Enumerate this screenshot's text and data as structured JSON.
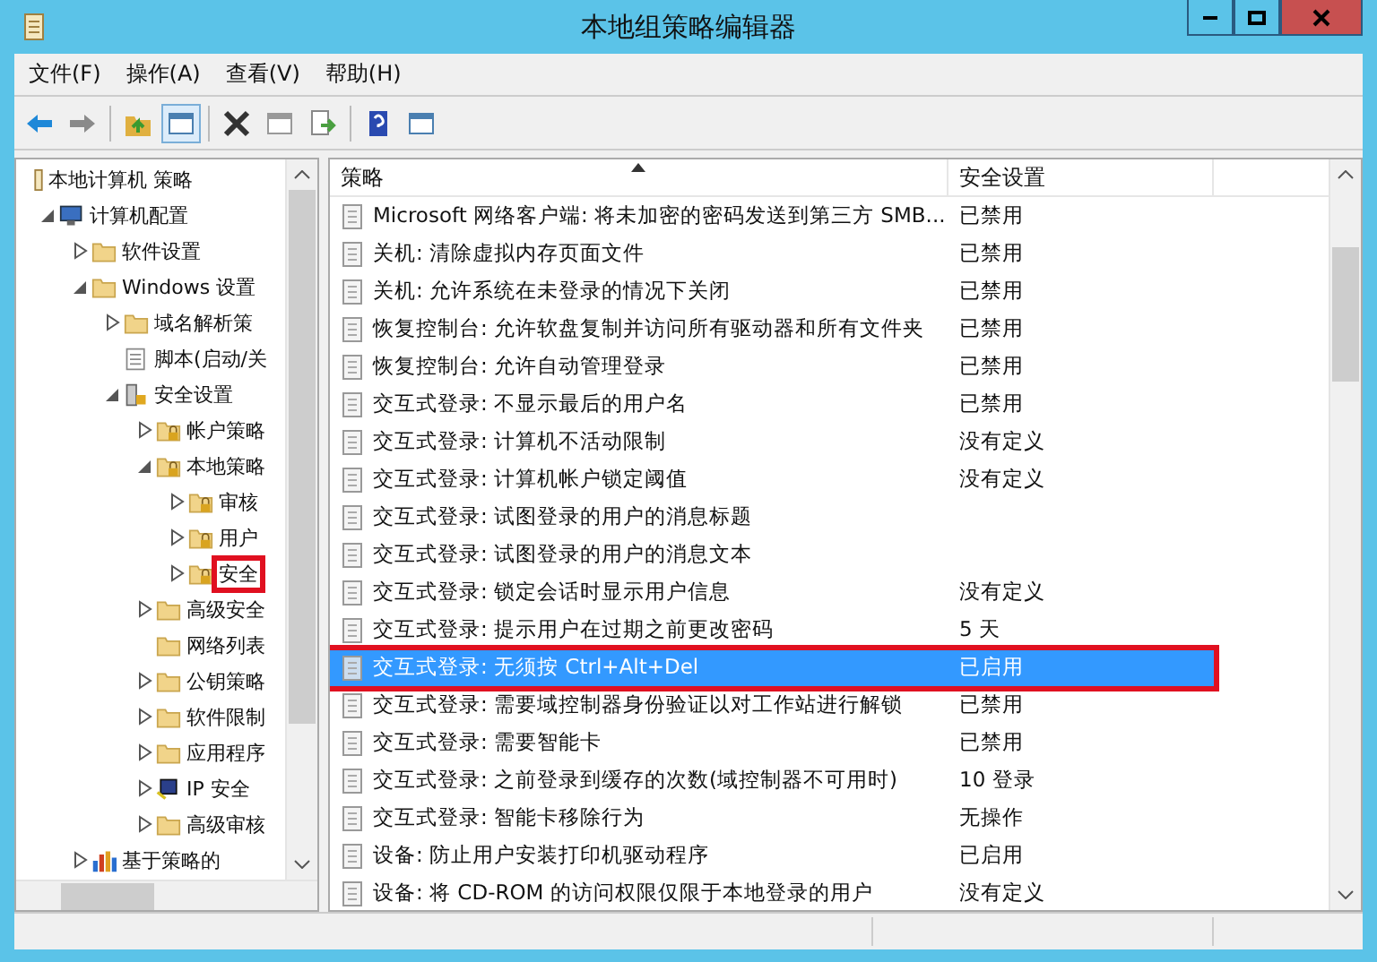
{
  "window": {
    "title": "本地组策略编辑器"
  },
  "menu": [
    {
      "label": "文件(F)"
    },
    {
      "label": "操作(A)"
    },
    {
      "label": "查看(V)"
    },
    {
      "label": "帮助(H)"
    }
  ],
  "toolbar": [
    {
      "kind": "back"
    },
    {
      "kind": "forward"
    },
    {
      "kind": "sep"
    },
    {
      "kind": "up"
    },
    {
      "kind": "pane",
      "selected": true
    },
    {
      "kind": "sep"
    },
    {
      "kind": "delete"
    },
    {
      "kind": "props"
    },
    {
      "kind": "export"
    },
    {
      "kind": "sep"
    },
    {
      "kind": "help"
    },
    {
      "kind": "view"
    }
  ],
  "tree": [
    {
      "label": "本地计算机 策略",
      "kind": "doc",
      "annotated": false,
      "children": [
        {
          "label": "计算机配置",
          "kind": "computer",
          "expanded": true,
          "annotated": false,
          "children": [
            {
              "label": "软件设置",
              "kind": "folder",
              "expanded": false,
              "annotated": false
            },
            {
              "label": "Windows 设置",
              "kind": "folder",
              "expanded": true,
              "annotated": false,
              "children": [
                {
                  "label": "域名解析策",
                  "kind": "folder",
                  "expanded": false,
                  "annotated": false
                },
                {
                  "label": "脚本(启动/关",
                  "kind": "script",
                  "annotated": false
                },
                {
                  "label": "安全设置",
                  "kind": "server",
                  "expanded": true,
                  "annotated": false,
                  "children": [
                    {
                      "label": "帐户策略",
                      "kind": "lockfolder",
                      "expanded": false,
                      "annotated": false
                    },
                    {
                      "label": "本地策略",
                      "kind": "lockfolder",
                      "expanded": true,
                      "annotated": false,
                      "children": [
                        {
                          "label": "审核",
                          "kind": "lockfolder",
                          "expanded": false,
                          "annotated": false
                        },
                        {
                          "label": "用户",
                          "kind": "lockfolder",
                          "expanded": false,
                          "annotated": false
                        },
                        {
                          "label": "安全",
                          "kind": "lockfolder",
                          "expanded": false,
                          "annotated": true
                        }
                      ]
                    },
                    {
                      "label": "高级安全",
                      "kind": "folder",
                      "expanded": false,
                      "annotated": false
                    },
                    {
                      "label": "网络列表",
                      "kind": "folder",
                      "annotated": false
                    },
                    {
                      "label": "公钥策略",
                      "kind": "folder",
                      "expanded": false,
                      "annotated": false
                    },
                    {
                      "label": "软件限制",
                      "kind": "folder",
                      "expanded": false,
                      "annotated": false
                    },
                    {
                      "label": "应用程序",
                      "kind": "folder",
                      "expanded": false,
                      "annotated": false
                    },
                    {
                      "label": "IP 安全",
                      "kind": "ipsec",
                      "expanded": false,
                      "annotated": false
                    },
                    {
                      "label": "高级审核",
                      "kind": "folder",
                      "expanded": false,
                      "annotated": false
                    }
                  ]
                }
              ]
            },
            {
              "label": "基于策略的",
              "kind": "chart",
              "expanded": false,
              "annotated": false
            }
          ]
        }
      ]
    }
  ],
  "table": {
    "columns": [
      {
        "label": "策略",
        "sorted": true
      },
      {
        "label": "安全设置",
        "sorted": false
      }
    ],
    "rows": [
      {
        "policy": "Microsoft 网络客户端: 将未加密的密码发送到第三方 SMB...",
        "setting": "已禁用",
        "selected": false,
        "annotated": false
      },
      {
        "policy": "关机: 清除虚拟内存页面文件",
        "setting": "已禁用",
        "selected": false,
        "annotated": false
      },
      {
        "policy": "关机: 允许系统在未登录的情况下关闭",
        "setting": "已禁用",
        "selected": false,
        "annotated": false
      },
      {
        "policy": "恢复控制台: 允许软盘复制并访问所有驱动器和所有文件夹",
        "setting": "已禁用",
        "selected": false,
        "annotated": false
      },
      {
        "policy": "恢复控制台: 允许自动管理登录",
        "setting": "已禁用",
        "selected": false,
        "annotated": false
      },
      {
        "policy": "交互式登录: 不显示最后的用户名",
        "setting": "已禁用",
        "selected": false,
        "annotated": false
      },
      {
        "policy": "交互式登录: 计算机不活动限制",
        "setting": "没有定义",
        "selected": false,
        "annotated": false
      },
      {
        "policy": "交互式登录: 计算机帐户锁定阈值",
        "setting": "没有定义",
        "selected": false,
        "annotated": false
      },
      {
        "policy": "交互式登录: 试图登录的用户的消息标题",
        "selected": false,
        "annotated": false
      },
      {
        "policy": "交互式登录: 试图登录的用户的消息文本",
        "selected": false,
        "annotated": false
      },
      {
        "policy": "交互式登录: 锁定会话时显示用户信息",
        "setting": "没有定义",
        "selected": false,
        "annotated": false
      },
      {
        "policy": "交互式登录: 提示用户在过期之前更改密码",
        "setting": "5 天",
        "selected": false,
        "annotated": false
      },
      {
        "policy": "交互式登录: 无须按 Ctrl+Alt+Del",
        "setting": "已启用",
        "selected": true,
        "annotated": true
      },
      {
        "policy": "交互式登录: 需要域控制器身份验证以对工作站进行解锁",
        "setting": "已禁用",
        "selected": false,
        "annotated": false
      },
      {
        "policy": "交互式登录: 需要智能卡",
        "setting": "已禁用",
        "selected": false,
        "annotated": false
      },
      {
        "policy": "交互式登录: 之前登录到缓存的次数(域控制器不可用时)",
        "setting": "10 登录",
        "selected": false,
        "annotated": false
      },
      {
        "policy": "交互式登录: 智能卡移除行为",
        "setting": "无操作",
        "selected": false,
        "annotated": false
      },
      {
        "policy": "设备: 防止用户安装打印机驱动程序",
        "setting": "已启用",
        "selected": false,
        "annotated": false
      },
      {
        "policy": "设备: 将 CD-ROM 的访问权限仅限于本地登录的用户",
        "setting": "没有定义",
        "selected": false,
        "annotated": false
      }
    ]
  }
}
